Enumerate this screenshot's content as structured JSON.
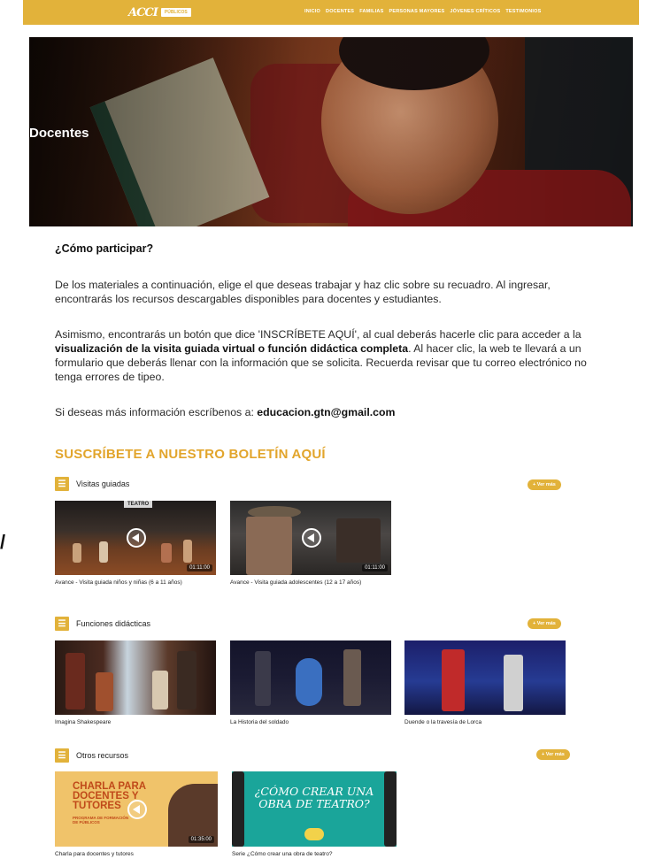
{
  "header": {
    "logo_mark": "ACCI",
    "logo_badge": "PÚBLICOS",
    "nav": [
      "INICIO",
      "DOCENTES",
      "FAMILIAS",
      "PERSONAS MAYORES",
      "JÓVENES CRÍTICOS",
      "TESTIMONIOS"
    ]
  },
  "hero": {
    "title": "Docentes"
  },
  "content": {
    "heading": "¿Cómo participar?",
    "p1": "De los materiales a continuación, elige el que deseas trabajar y haz clic sobre su recuadro. Al ingresar, encontrarás los recursos descargables disponibles para docentes y estudiantes.",
    "p2_a": "Asimismo, encontrarás un botón que dice 'INSCRÍBETE AQUÍ', al cual deberás hacerle clic para acceder a la ",
    "p2_bold": "visualización de la visita guiada virtual o función didáctica completa",
    "p2_b": ". Al hacer clic, la web te llevará a un formulario que deberás llenar con la información que se solicita. Recuerda revisar que tu correo electrónico no tenga errores de tipeo.",
    "p3_a": "Si deseas más información escríbenos a: ",
    "email": "educacion.gtn@gmail.com"
  },
  "subscribe": "SUSCRÍBETE A NUESTRO BOLETÍN AQUÍ",
  "ver_mas": "+ Ver más",
  "sections": {
    "visitas": {
      "title": "Visitas guiadas",
      "cards": [
        {
          "caption": "Avance - Visita guiada niños y niñas (6 a 11 años)",
          "duration": "01:11:00",
          "stage_label": "TEATRO"
        },
        {
          "caption": "Avance - Visita guiada adolescentes (12 a 17 años)",
          "duration": "01:11:00"
        }
      ]
    },
    "funciones": {
      "title": "Funciones didácticas",
      "cards": [
        {
          "caption": "Imagina Shakespeare"
        },
        {
          "caption": "La Historia del soldado"
        },
        {
          "caption": "Duende o la travesía de Lorca"
        }
      ]
    },
    "otros": {
      "title": "Otros recursos",
      "cards": [
        {
          "caption": "Charla para docentes y tutores",
          "duration": "01:35:00",
          "art_title": "CHARLA PARA DOCENTES Y TUTORES",
          "art_sub": "PROGRAMA DE FORMACIÓN DE PÚBLICOS"
        },
        {
          "caption": "Serie ¿Cómo crear una obra de teatro?",
          "art_title": "¿CÓMO CREAR UNA OBRA DE TEATRO?"
        }
      ]
    }
  },
  "side_mark": "/"
}
